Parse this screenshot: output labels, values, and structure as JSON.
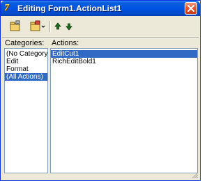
{
  "window": {
    "title": "Editing Form1.ActionList1",
    "icon": "delphi-icon",
    "close_icon": "close-icon"
  },
  "toolbar": {
    "buttons": [
      {
        "icon": "new-action-icon"
      },
      {
        "icon": "new-standard-action-icon"
      },
      {
        "icon": "move-up-icon"
      },
      {
        "icon": "move-down-icon"
      }
    ]
  },
  "categories": {
    "label": "Categories:",
    "items": [
      {
        "label": "(No Category)",
        "selected": false
      },
      {
        "label": "Edit",
        "selected": false
      },
      {
        "label": "Format",
        "selected": false
      },
      {
        "label": "(All Actions)",
        "selected": true
      }
    ]
  },
  "actions": {
    "label": "Actions:",
    "items": [
      {
        "label": "EditCut1",
        "selected": true
      },
      {
        "label": "RichEditBold1",
        "selected": false
      }
    ]
  },
  "colors": {
    "title_bar": "#0054e3",
    "selection": "#316ac5",
    "window_bg": "#ece9d8",
    "list_border": "#7f9db9"
  }
}
